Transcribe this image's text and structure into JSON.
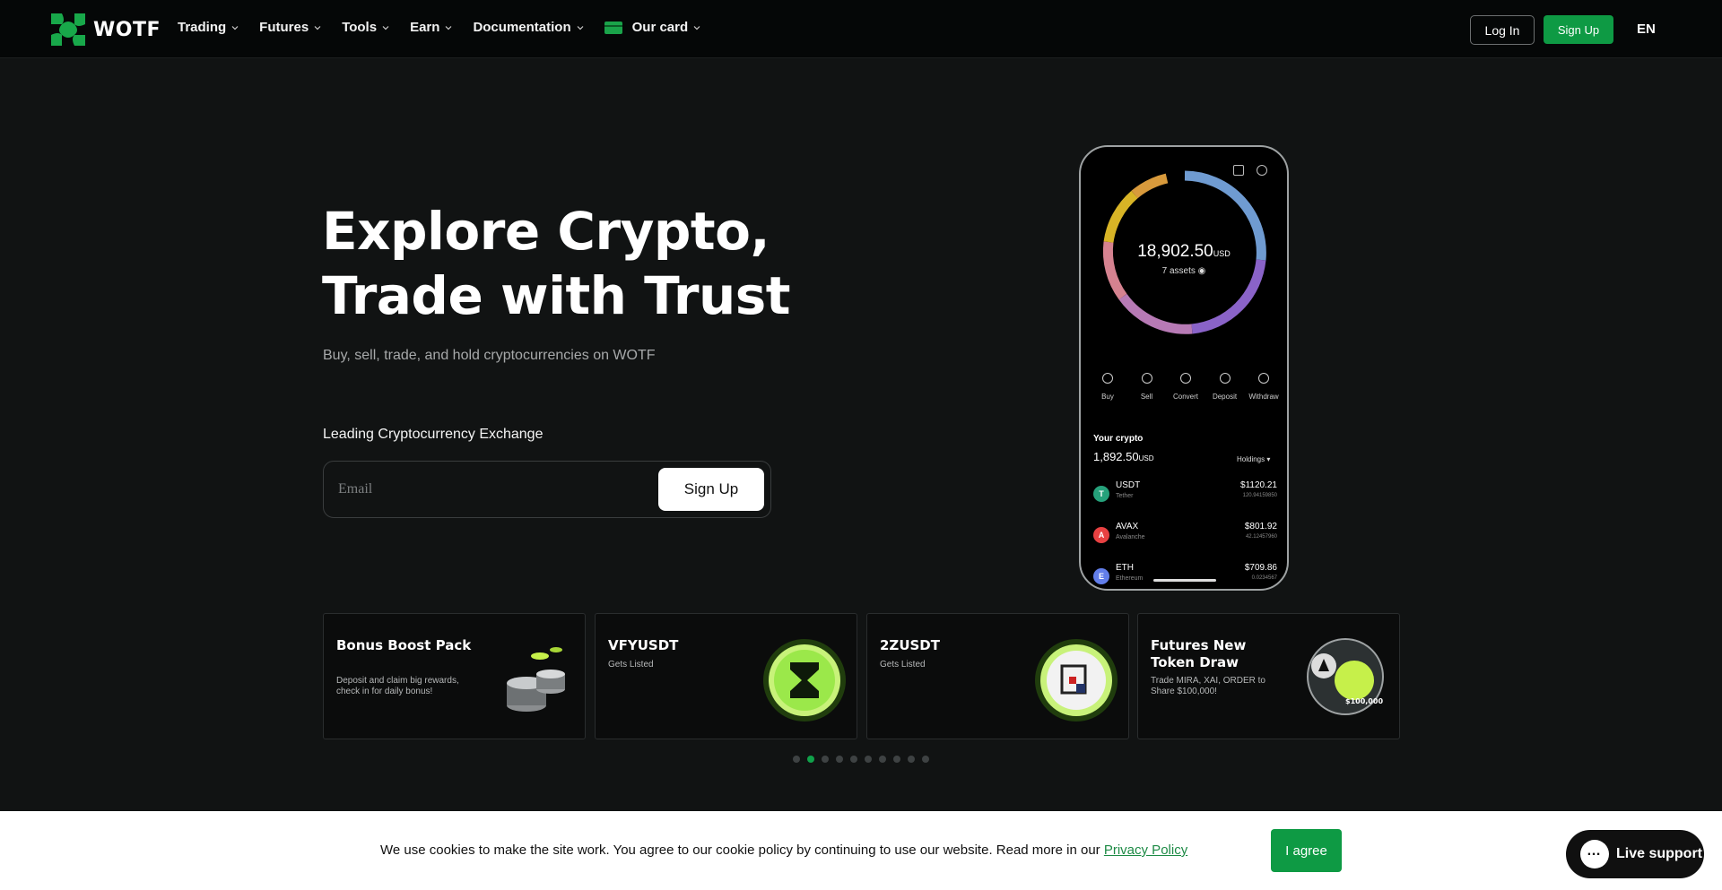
{
  "nav": {
    "brand": "WOTF",
    "items": [
      "Trading",
      "Futures",
      "Tools",
      "Earn",
      "Documentation"
    ],
    "card_item": "Our card",
    "login": "Log In",
    "signup": "Sign Up",
    "lang": "EN"
  },
  "hero": {
    "title_line1": "Explore Crypto,",
    "title_line2": "Trade with Trust",
    "subtitle": "Buy, sell, trade, and hold cryptocurrencies on WOTF",
    "lead": "Leading Cryptocurrency Exchange",
    "email_placeholder": "Email",
    "signup_button": "Sign Up"
  },
  "phone": {
    "total": "18,902.50",
    "total_unit": "USD",
    "assets": "7 assets",
    "actions": [
      "Buy",
      "Sell",
      "Convert",
      "Deposit",
      "Withdraw"
    ],
    "your_crypto": "Your crypto",
    "balance": "1,892.50",
    "balance_unit": "USD",
    "holdings": "Holdings",
    "coins": [
      {
        "symbol": "USDT",
        "name": "Tether",
        "value": "$1120.21",
        "amount": "120.94159850",
        "color": "#26a17b",
        "glyph": "T"
      },
      {
        "symbol": "AVAX",
        "name": "Avalanche",
        "value": "$801.92",
        "amount": "42.12457960",
        "color": "#e84142",
        "glyph": "A"
      },
      {
        "symbol": "ETH",
        "name": "Ethereum",
        "value": "$709.86",
        "amount": "0.0234567",
        "color": "#627eea",
        "glyph": "E"
      }
    ]
  },
  "promos": [
    {
      "title": "Bonus Boost Pack",
      "desc": "Deposit and claim big rewards, check in for daily bonus!"
    },
    {
      "title": "VFYUSDT",
      "desc": "Gets Listed"
    },
    {
      "title": "2ZUSDT",
      "desc": "Gets Listed"
    },
    {
      "title": "Futures New Token Draw",
      "desc": "Trade MIRA, XAI, ORDER to Share $100,000!",
      "badge": "$100,000"
    }
  ],
  "carousel": {
    "total": 10,
    "active": 1
  },
  "cookie": {
    "text": "We use cookies to make the site work. You agree to our cookie policy by continuing to use our website. Read more in our ",
    "link": "Privacy Policy",
    "agree": "I agree"
  },
  "support": {
    "label": "Live support"
  },
  "colors": {
    "accent": "#0e9a44",
    "background": "#111313"
  }
}
